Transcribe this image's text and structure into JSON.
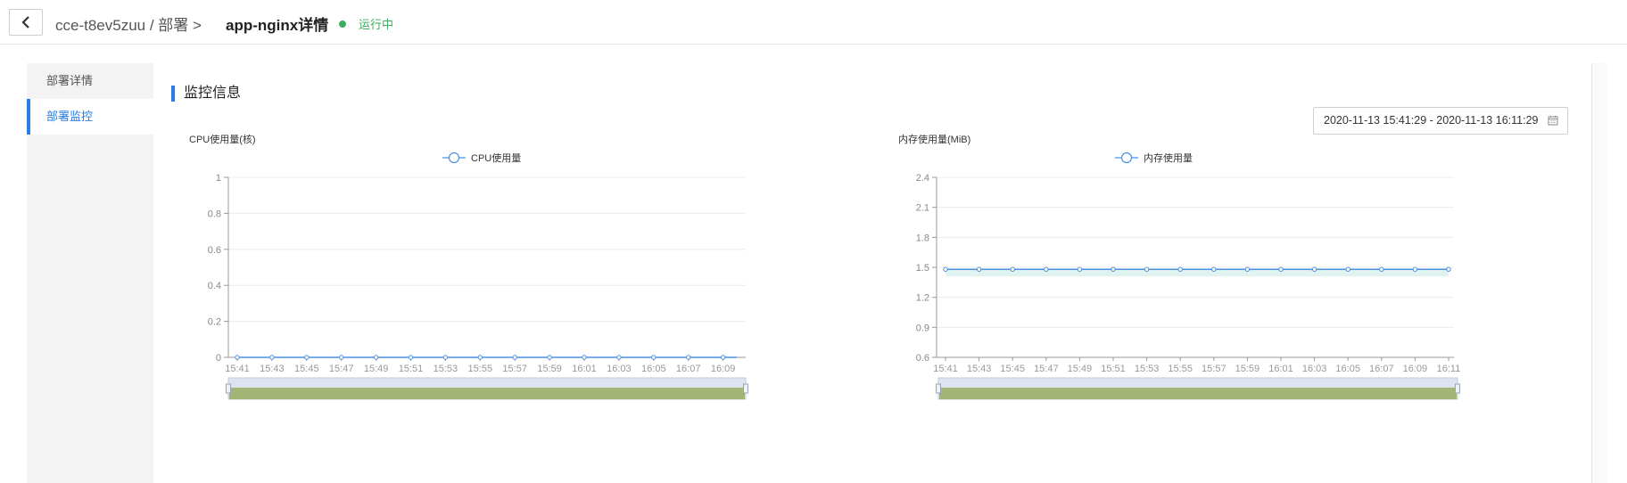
{
  "header": {
    "breadcrumb": "cce-t8ev5zuu / 部署 >",
    "title": "app-nginx详情",
    "status": "运行中"
  },
  "sidebar": {
    "items": [
      {
        "label": "部署详情",
        "active": false
      },
      {
        "label": "部署监控",
        "active": true
      }
    ]
  },
  "main": {
    "section_title": "监控信息",
    "date_range": "2020-11-13 15:41:29 - 2020-11-13 16:11:29"
  },
  "colors": {
    "accent": "#2b7de1",
    "line": "#4a90e2",
    "status": "#3aae5c",
    "zoom_fill": "#a3b575",
    "zoom_bg": "#dde3ef"
  },
  "chart_data": [
    {
      "type": "line",
      "title": "CPU使用量(核)",
      "legend": [
        "CPU使用量"
      ],
      "legend_placement": "top",
      "grid": true,
      "ylim": [
        0,
        1
      ],
      "yticks": [
        "0",
        "0.2",
        "0.4",
        "0.6",
        "0.8",
        "1"
      ],
      "x": [
        "15:41",
        "15:43",
        "15:45",
        "15:47",
        "15:49",
        "15:51",
        "15:53",
        "15:55",
        "15:57",
        "15:59",
        "16:01",
        "16:03",
        "16:05",
        "16:07",
        "16:09"
      ],
      "series": [
        {
          "name": "CPU使用量",
          "values": [
            0,
            0,
            0,
            0,
            0,
            0,
            0,
            0,
            0,
            0,
            0,
            0,
            0,
            0,
            0
          ]
        }
      ]
    },
    {
      "type": "area",
      "title": "内存使用量(MiB)",
      "legend": [
        "内存使用量"
      ],
      "legend_placement": "top",
      "grid": true,
      "ylim": [
        0.6,
        2.4
      ],
      "yticks": [
        "0.6",
        "0.9",
        "1.2",
        "1.5",
        "1.8",
        "2.1",
        "2.4"
      ],
      "x": [
        "15:41",
        "15:43",
        "15:45",
        "15:47",
        "15:49",
        "15:51",
        "15:53",
        "15:55",
        "15:57",
        "15:59",
        "16:01",
        "16:03",
        "16:05",
        "16:07",
        "16:09",
        "16:11"
      ],
      "series": [
        {
          "name": "内存使用量",
          "values": [
            1.48,
            1.48,
            1.48,
            1.48,
            1.48,
            1.48,
            1.48,
            1.48,
            1.48,
            1.48,
            1.48,
            1.48,
            1.48,
            1.48,
            1.48,
            1.48
          ]
        }
      ]
    }
  ]
}
